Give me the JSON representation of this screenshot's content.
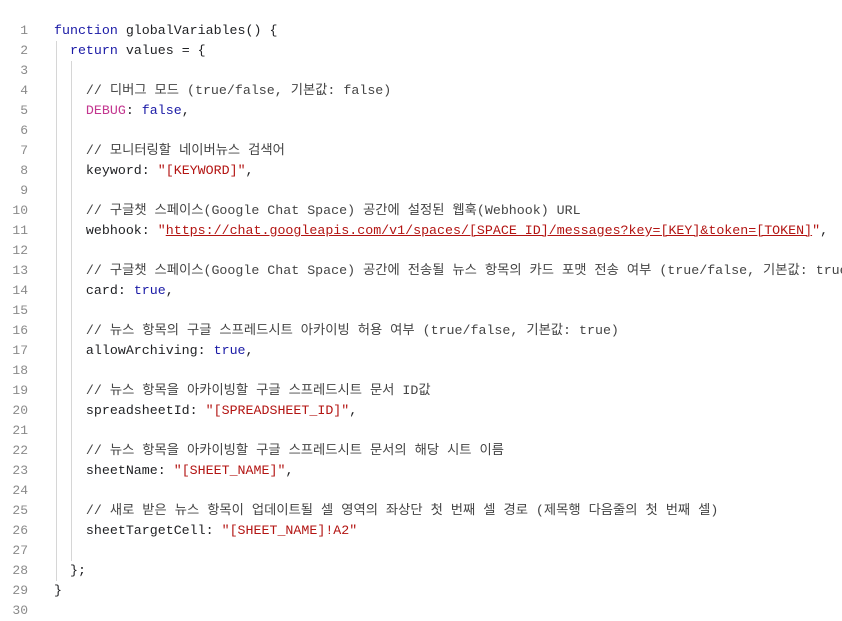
{
  "line_numbers": [
    "1",
    "2",
    "3",
    "4",
    "5",
    "6",
    "7",
    "8",
    "9",
    "10",
    "11",
    "12",
    "13",
    "14",
    "15",
    "16",
    "17",
    "18",
    "19",
    "20",
    "21",
    "22",
    "23",
    "24",
    "25",
    "26",
    "27",
    "28",
    "29",
    "30"
  ],
  "code": {
    "l1": {
      "kw": "function",
      "rest": " globalVariables() {"
    },
    "l2": {
      "kw": "return",
      "rest": " values = {"
    },
    "l4": {
      "comment": "// 디버그 모드 (true/false, 기본값: false)"
    },
    "l5": {
      "key": "DEBUG",
      "sep": ": ",
      "val": "false",
      "end": ","
    },
    "l7": {
      "comment": "// 모니터링할 네이버뉴스 검색어"
    },
    "l8": {
      "key": "keyword",
      "sep": ": ",
      "q1": "\"",
      "val": "[KEYWORD]",
      "q2": "\"",
      "end": ","
    },
    "l10": {
      "comment": "// 구글챗 스페이스(Google Chat Space) 공간에 설정된 웹훅(Webhook) URL"
    },
    "l11": {
      "key": "webhook",
      "sep": ": ",
      "q1": "\"",
      "val": "https://chat.googleapis.com/v1/spaces/[SPACE_ID]/messages?key=[KEY]&token=[TOKEN]",
      "q2": "\"",
      "end": ","
    },
    "l13": {
      "comment": "// 구글챗 스페이스(Google Chat Space) 공간에 전송될 뉴스 항목의 카드 포맷 전송 여부 (true/false, 기본값: true)"
    },
    "l14": {
      "key": "card",
      "sep": ": ",
      "val": "true",
      "end": ","
    },
    "l16": {
      "comment": "// 뉴스 항목의 구글 스프레드시트 아카이빙 허용 여부 (true/false, 기본값: true)"
    },
    "l17": {
      "key": "allowArchiving",
      "sep": ": ",
      "val": "true",
      "end": ","
    },
    "l19": {
      "comment": "// 뉴스 항목을 아카이빙할 구글 스프레드시트 문서 ID값"
    },
    "l20": {
      "key": "spreadsheetId",
      "sep": ": ",
      "q1": "\"",
      "val": "[SPREADSHEET_ID]",
      "q2": "\"",
      "end": ","
    },
    "l22": {
      "comment": "// 뉴스 항목을 아카이빙할 구글 스프레드시트 문서의 해당 시트 이름"
    },
    "l23": {
      "key": "sheetName",
      "sep": ": ",
      "q1": "\"",
      "val": "[SHEET_NAME]",
      "q2": "\"",
      "end": ","
    },
    "l25": {
      "comment": "// 새로 받은 뉴스 항목이 업데이트될 셀 영역의 좌상단 첫 번째 셀 경로 (제목행 다음줄의 첫 번째 셀)"
    },
    "l26": {
      "key": "sheetTargetCell",
      "sep": ": ",
      "q1": "\"",
      "val": "[SHEET_NAME]!A2",
      "q2": "\""
    },
    "l28": {
      "text": "};"
    },
    "l29": {
      "text": "}"
    }
  },
  "colors": {
    "keyword": "#1a1aa6",
    "string": "#b31412",
    "debug_identifier": "#c3368f",
    "line_number": "#8a8a8a"
  }
}
